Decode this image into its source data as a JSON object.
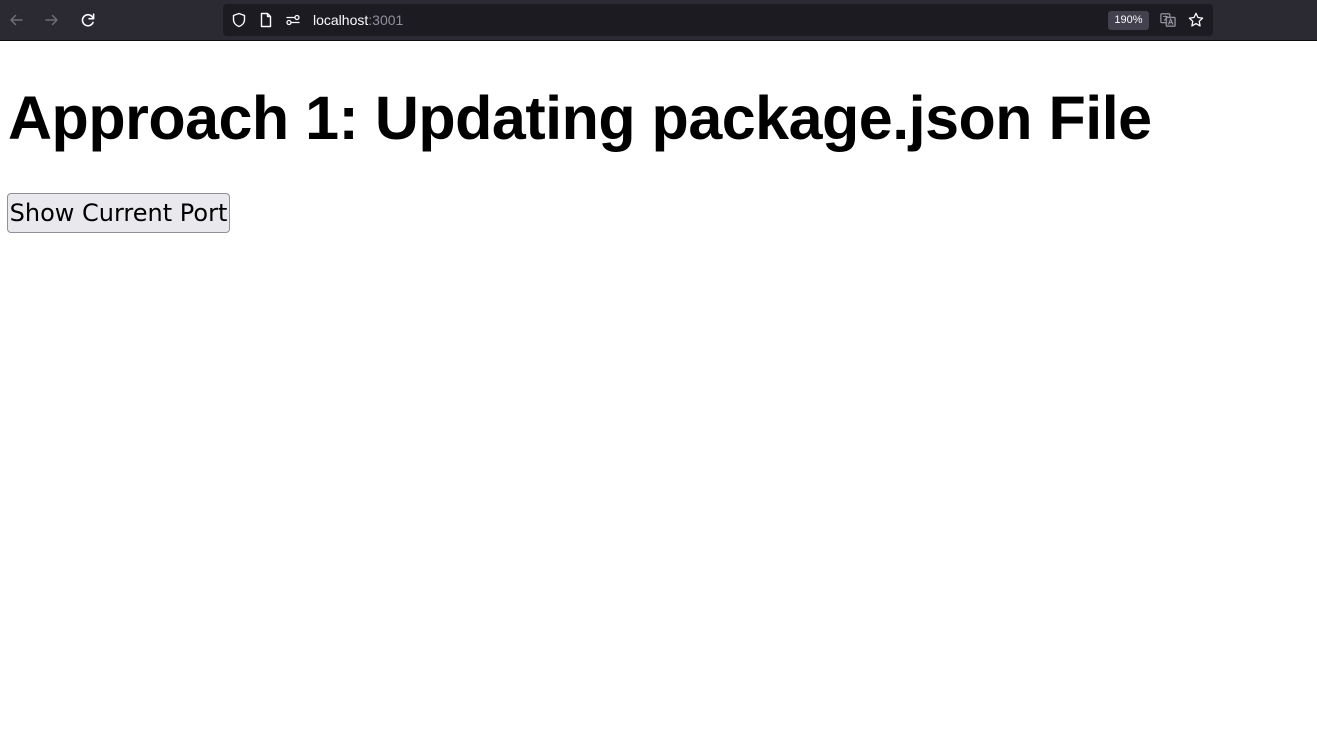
{
  "browser": {
    "url_host": "localhost",
    "url_port": ":3001",
    "zoom_level": "190%",
    "icons": {
      "back": "back-arrow-icon",
      "forward": "forward-arrow-icon",
      "reload": "reload-icon",
      "tracking": "shield-icon",
      "page": "page-icon",
      "permissions": "permissions-icon",
      "translate": "translate-icon",
      "bookmark": "star-icon"
    }
  },
  "page": {
    "heading": "Approach 1: Updating package.json File",
    "button_label": "Show Current Port"
  },
  "colors": {
    "toolbar_bg": "#2b2a33",
    "urlbar_bg": "#1c1b22",
    "button_bg": "#e9e9ed"
  }
}
